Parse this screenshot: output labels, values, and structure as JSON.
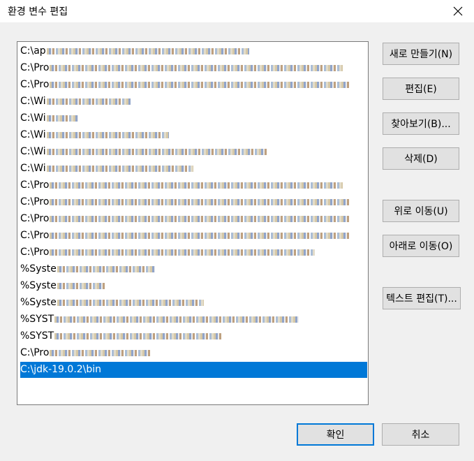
{
  "window": {
    "title": "환경 변수 편집"
  },
  "list": {
    "items": [
      "C:\\ap",
      "C:\\Pro",
      "C:\\Pro",
      "C:\\Wi",
      "C:\\Wi",
      "C:\\Wi",
      "C:\\Wi",
      "C:\\Wi",
      "C:\\Pro",
      "C:\\Pro",
      "C:\\Pro",
      "C:\\Pro",
      "C:\\Pro",
      "%Syste",
      "%Syste",
      "%Syste",
      "%SYST",
      "%SYST",
      "C:\\Pro",
      "C:\\jdk-19.0.2\\bin"
    ],
    "selected_index": 19
  },
  "buttons": {
    "new": "새로 만들기(N)",
    "edit": "편집(E)",
    "browse": "찾아보기(B)...",
    "delete": "삭제(D)",
    "move_up": "위로 이동(U)",
    "move_down": "아래로 이동(O)",
    "edit_text": "텍스트 편집(T)...",
    "ok": "확인",
    "cancel": "취소"
  },
  "icons": {
    "close": "close-icon"
  },
  "colors": {
    "selection": "#0078d7",
    "dialog_bg": "#f0f0f0"
  }
}
